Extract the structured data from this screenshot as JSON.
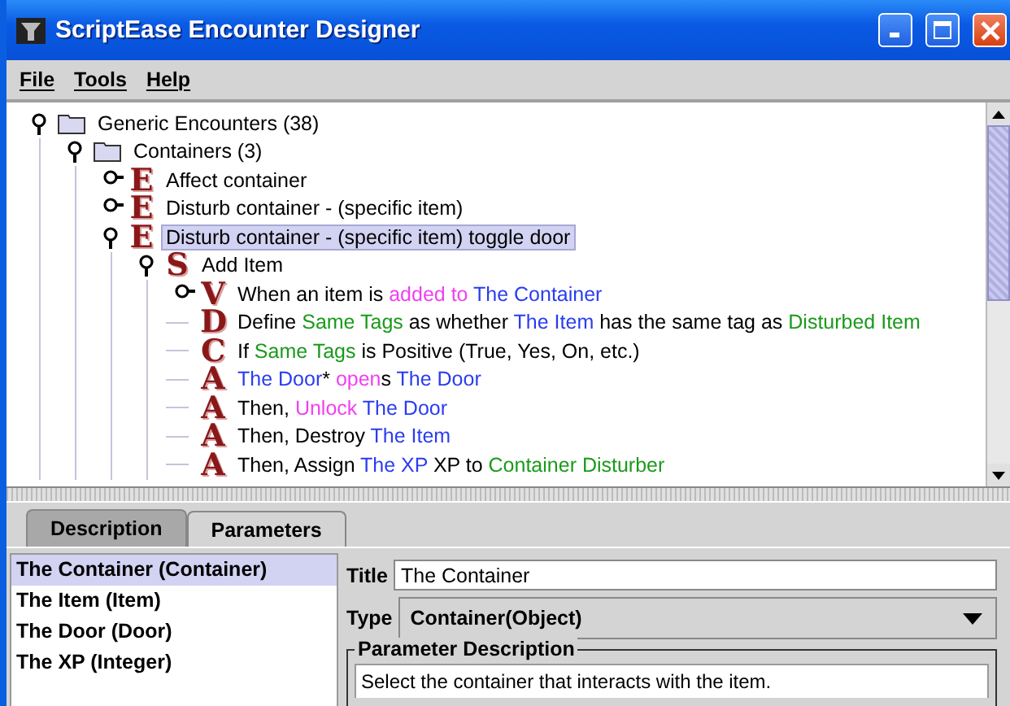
{
  "window": {
    "title": "ScriptEase Encounter Designer"
  },
  "menu": [
    "File",
    "Tools",
    "Help"
  ],
  "tree": [
    {
      "icon": {
        "kind": "folder"
      },
      "expanded": true,
      "selected": false,
      "parts": [
        {
          "text": "Generic Encounters (38)",
          "kind": "plain"
        }
      ],
      "children": [
        {
          "icon": {
            "kind": "folder"
          },
          "expanded": true,
          "selected": false,
          "parts": [
            {
              "text": "Containers (3)",
              "kind": "plain"
            }
          ],
          "children": [
            {
              "icon": {
                "kind": "letter",
                "glyph": "E"
              },
              "expanded": false,
              "selected": false,
              "parts": [
                {
                  "text": "Affect container",
                  "kind": "plain"
                }
              ]
            },
            {
              "icon": {
                "kind": "letter",
                "glyph": "E"
              },
              "expanded": false,
              "selected": false,
              "parts": [
                {
                  "text": "Disturb container - (specific item)",
                  "kind": "plain"
                }
              ]
            },
            {
              "icon": {
                "kind": "letter",
                "glyph": "E"
              },
              "expanded": true,
              "selected": true,
              "parts": [
                {
                  "text": "Disturb container - (specific item) toggle door",
                  "kind": "plain"
                }
              ],
              "children": [
                {
                  "icon": {
                    "kind": "letter",
                    "glyph": "S"
                  },
                  "expanded": true,
                  "selected": false,
                  "parts": [
                    {
                      "text": "Add Item",
                      "kind": "plain"
                    }
                  ],
                  "children": [
                    {
                      "icon": {
                        "kind": "letter",
                        "glyph": "V"
                      },
                      "expanded": false,
                      "selected": false,
                      "parts": [
                        {
                          "text": "When an item is ",
                          "kind": "plain"
                        },
                        {
                          "text": "added to ",
                          "kind": "verb"
                        },
                        {
                          "text": "The Container",
                          "kind": "param"
                        }
                      ]
                    },
                    {
                      "icon": {
                        "kind": "letter",
                        "glyph": "D"
                      },
                      "selected": false,
                      "parts": [
                        {
                          "text": "Define ",
                          "kind": "plain"
                        },
                        {
                          "text": "Same Tags",
                          "kind": "variable"
                        },
                        {
                          "text": " as whether ",
                          "kind": "plain"
                        },
                        {
                          "text": "The Item",
                          "kind": "param"
                        },
                        {
                          "text": " has the same tag as ",
                          "kind": "plain"
                        },
                        {
                          "text": "Disturbed Item",
                          "kind": "variable"
                        }
                      ]
                    },
                    {
                      "icon": {
                        "kind": "letter",
                        "glyph": "C"
                      },
                      "selected": false,
                      "parts": [
                        {
                          "text": "If ",
                          "kind": "plain"
                        },
                        {
                          "text": "Same Tags",
                          "kind": "variable"
                        },
                        {
                          "text": " is Positive (True, Yes, On, etc.)",
                          "kind": "plain"
                        }
                      ]
                    },
                    {
                      "icon": {
                        "kind": "letter",
                        "glyph": "A"
                      },
                      "selected": false,
                      "parts": [
                        {
                          "text": "The Door",
                          "kind": "param"
                        },
                        {
                          "text": "* ",
                          "kind": "plain"
                        },
                        {
                          "text": "open",
                          "kind": "verb"
                        },
                        {
                          "text": "s ",
                          "kind": "plain"
                        },
                        {
                          "text": "The Door",
                          "kind": "param"
                        }
                      ]
                    },
                    {
                      "icon": {
                        "kind": "letter",
                        "glyph": "A"
                      },
                      "selected": false,
                      "parts": [
                        {
                          "text": "Then, ",
                          "kind": "plain"
                        },
                        {
                          "text": "Unlock ",
                          "kind": "verb"
                        },
                        {
                          "text": "The Door",
                          "kind": "param"
                        }
                      ]
                    },
                    {
                      "icon": {
                        "kind": "letter",
                        "glyph": "A"
                      },
                      "selected": false,
                      "parts": [
                        {
                          "text": "Then, Destroy ",
                          "kind": "plain"
                        },
                        {
                          "text": "The Item",
                          "kind": "param"
                        }
                      ]
                    },
                    {
                      "icon": {
                        "kind": "letter",
                        "glyph": "A"
                      },
                      "selected": false,
                      "parts": [
                        {
                          "text": "Then, Assign ",
                          "kind": "plain"
                        },
                        {
                          "text": "The XP",
                          "kind": "param"
                        },
                        {
                          "text": " XP to ",
                          "kind": "plain"
                        },
                        {
                          "text": "Container Disturber",
                          "kind": "variable"
                        }
                      ]
                    }
                  ]
                }
              ]
            }
          ]
        }
      ]
    }
  ],
  "tabs": [
    {
      "label": "Description",
      "selected": false
    },
    {
      "label": "Parameters",
      "selected": true
    }
  ],
  "parameters": [
    {
      "label": "The Container (Container)",
      "selected": true
    },
    {
      "label": "The Item (Item)",
      "selected": false
    },
    {
      "label": "The Door (Door)",
      "selected": false
    },
    {
      "label": "The XP (Integer)",
      "selected": false
    }
  ],
  "details": {
    "title_label": "Title",
    "title_value": "The Container",
    "type_label": "Type",
    "type_value": "Container(Object)",
    "description_legend": "Parameter Description",
    "description_text": "Select the container that interacts with the item."
  }
}
